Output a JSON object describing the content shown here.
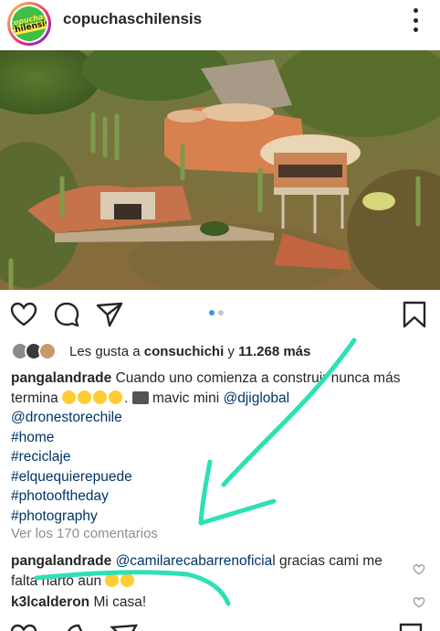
{
  "post": {
    "username": "copuchaschilensis",
    "avatar_text_top": "copuchas",
    "avatar_text_bottom": "chilensis"
  },
  "photo": {
    "description_icon": "photo"
  },
  "actions": {
    "like_icon": "heart-icon",
    "comment_icon": "comment-icon",
    "share_icon": "share-icon",
    "save_icon": "bookmark-icon",
    "carousel_index": 1,
    "carousel_total": 2
  },
  "likes": {
    "prefix": "Les gusta a ",
    "user": "consuchichi",
    "connector": " y ",
    "count": "11.268 más"
  },
  "caption": {
    "author": "pangalandrade",
    "text": "Cuando uno comienza a construir nunca más termina",
    "after_emojis": ". ",
    "device": "mavic mini",
    "mention_1": "@djiglobal",
    "mention_2": "@dronestorechile",
    "hashtags": [
      "#home",
      "#reciclaje",
      "#elquequierepuede",
      "#photooftheday",
      "#photography"
    ]
  },
  "view_comments": "Ver los 170 comentarios",
  "comments": [
    {
      "author": "pangalandrade",
      "mention": "@camilarecabarrenoficial",
      "text": "gracias cami me falta harto aún"
    },
    {
      "author": "k3lcalderon",
      "mention": "",
      "text": "Mi casa!"
    }
  ],
  "colors": {
    "link": "#003569",
    "muted": "#8e8e8e",
    "accent_dot": "#3897f0",
    "annotation_stroke": "#2ee0b5"
  }
}
